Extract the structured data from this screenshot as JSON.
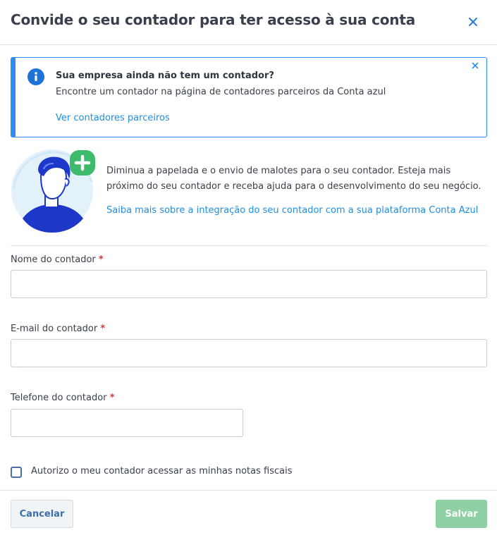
{
  "dialog": {
    "title": "Convide o seu contador para ter acesso à sua conta"
  },
  "alert": {
    "title": "Sua empresa ainda não tem um contador?",
    "text": "Encontre um contador na página de contadores parceiros da Conta azul",
    "link": "Ver contadores parceiros"
  },
  "intro": {
    "text": "Diminua a papelada e o envio de malotes para o seu contador. Esteja mais próximo do seu contador e receba ajuda para o desenvolvimento do seu negócio.",
    "link": "Saiba mais sobre a integração do seu contador com a sua plataforma Conta Azul"
  },
  "form": {
    "name_label": "Nome do contador",
    "email_label": "E-mail do contador",
    "phone_label": "Telefone do contador",
    "required_mark": "*",
    "name_value": "",
    "email_value": "",
    "phone_value": ""
  },
  "consent": {
    "label": "Autorizo o meu contador acessar as minhas notas fiscais",
    "checked": false
  },
  "footer": {
    "cancel_label": "Cancelar",
    "save_label": "Salvar"
  },
  "colors": {
    "accent": "#2a8ef2",
    "link": "#1f8ee0",
    "required": "#d63a3a",
    "save_disabled": "#8fd0a4",
    "add_badge": "#3dbb6b"
  },
  "icons": {
    "close": "close-icon",
    "info": "info-icon",
    "alert_close": "close-icon",
    "illustration": "accountant-avatar-illustration",
    "add": "plus-circle-icon"
  }
}
